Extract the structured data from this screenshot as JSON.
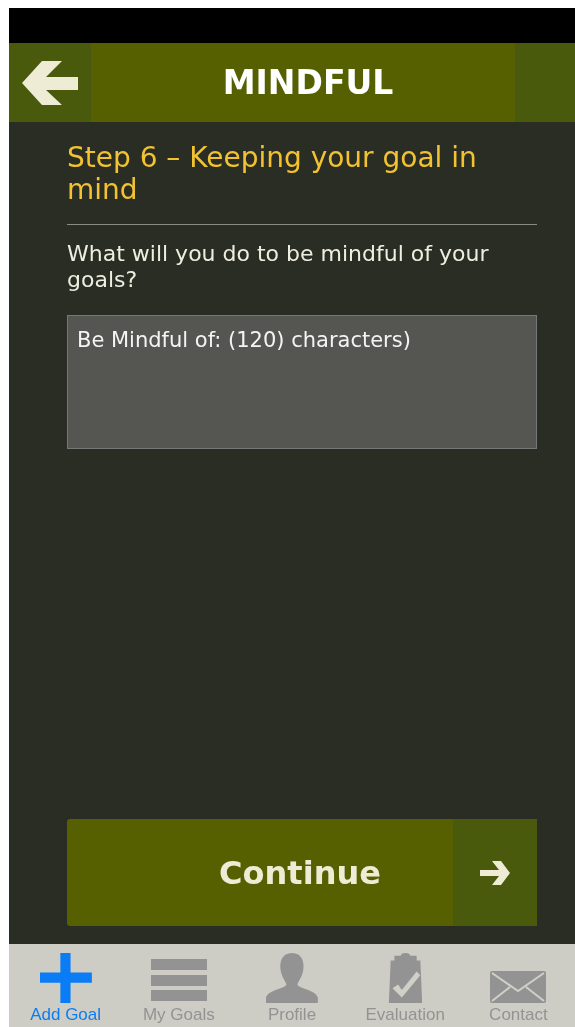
{
  "header": {
    "title": "MINDFUL"
  },
  "step_title": "Step 6 – Keeping your goal in mind",
  "question": "What will you do to be mindful of your goals?",
  "answer_field": {
    "placeholder": "Be Mindful of: (120) characters)"
  },
  "continue_button": {
    "label": "Continue"
  },
  "tab_bar": [
    {
      "label": "Add Goal",
      "kind": "plus",
      "selected": true
    },
    {
      "label": "My Goals",
      "kind": "list",
      "selected": false
    },
    {
      "label": "Profile",
      "kind": "person",
      "selected": false
    },
    {
      "label": "Evaluation",
      "kind": "clipboard",
      "selected": false
    },
    {
      "label": "Contact",
      "kind": "mail",
      "selected": false
    }
  ]
}
